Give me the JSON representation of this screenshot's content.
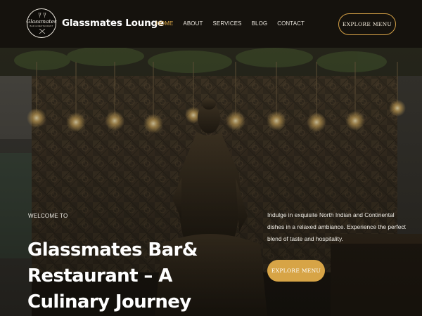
{
  "header": {
    "brand": "Glassmates Lounge",
    "logo_script": "Glassmates",
    "logo_sub": "BAR & RESTAURANT",
    "cta_label": "EXPLORE MENU"
  },
  "nav": {
    "items": [
      {
        "label": "HOME",
        "active": true
      },
      {
        "label": "ABOUT",
        "active": false
      },
      {
        "label": "SERVICES",
        "active": false
      },
      {
        "label": "BLOG",
        "active": false
      },
      {
        "label": "CONTACT",
        "active": false
      }
    ]
  },
  "hero": {
    "welcome": "WELCOME TO",
    "headline": "Glassmates Bar& Restaurant – A Culinary Journey",
    "description": "Indulge in exquisite North Indian and Continental dishes in a relaxed ambiance. Experience the perfect blend of taste and hospitality.",
    "cta_label": "EXPLORE MENU"
  },
  "colors": {
    "accent": "#d7a446",
    "header_bg": "#15120d",
    "active_nav": "#d9a648"
  },
  "icons": {
    "logo": "glasses-logo-icon"
  }
}
